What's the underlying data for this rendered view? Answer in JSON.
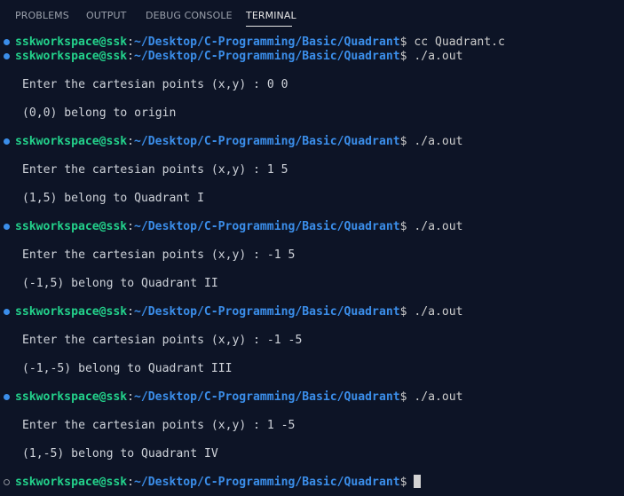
{
  "panel": {
    "tabs": [
      {
        "label": "PROBLEMS"
      },
      {
        "label": "OUTPUT"
      },
      {
        "label": "DEBUG CONSOLE"
      },
      {
        "label": "TERMINAL"
      }
    ],
    "active_tab": "TERMINAL"
  },
  "terminal": {
    "user_host": "sskworkspace@ssk",
    "path": "~/Desktop/C-Programming/Basic/Quadrant",
    "dollar": "$",
    "commands": [
      "cc Quadrant.c",
      "./a.out",
      "./a.out",
      "./a.out",
      "./a.out",
      "./a.out"
    ],
    "outputs": [
      {
        "prompt": "Enter the cartesian points (x,y) : 0 0",
        "result": "(0,0) belong to origin"
      },
      {
        "prompt": "Enter the cartesian points (x,y) : 1 5",
        "result": "(1,5) belong to Quadrant I"
      },
      {
        "prompt": "Enter the cartesian points (x,y) : -1 5",
        "result": "(-1,5) belong to Quadrant II"
      },
      {
        "prompt": "Enter the cartesian points (x,y) : -1 -5",
        "result": "(-1,-5) belong to Quadrant III"
      },
      {
        "prompt": "Enter the cartesian points (x,y) : 1 -5",
        "result": "(1,-5) belong to Quadrant IV"
      }
    ]
  },
  "colors": {
    "background": "#0d1426",
    "user_host": "#23d18b",
    "path": "#3b8eea",
    "text": "#cccccc"
  }
}
